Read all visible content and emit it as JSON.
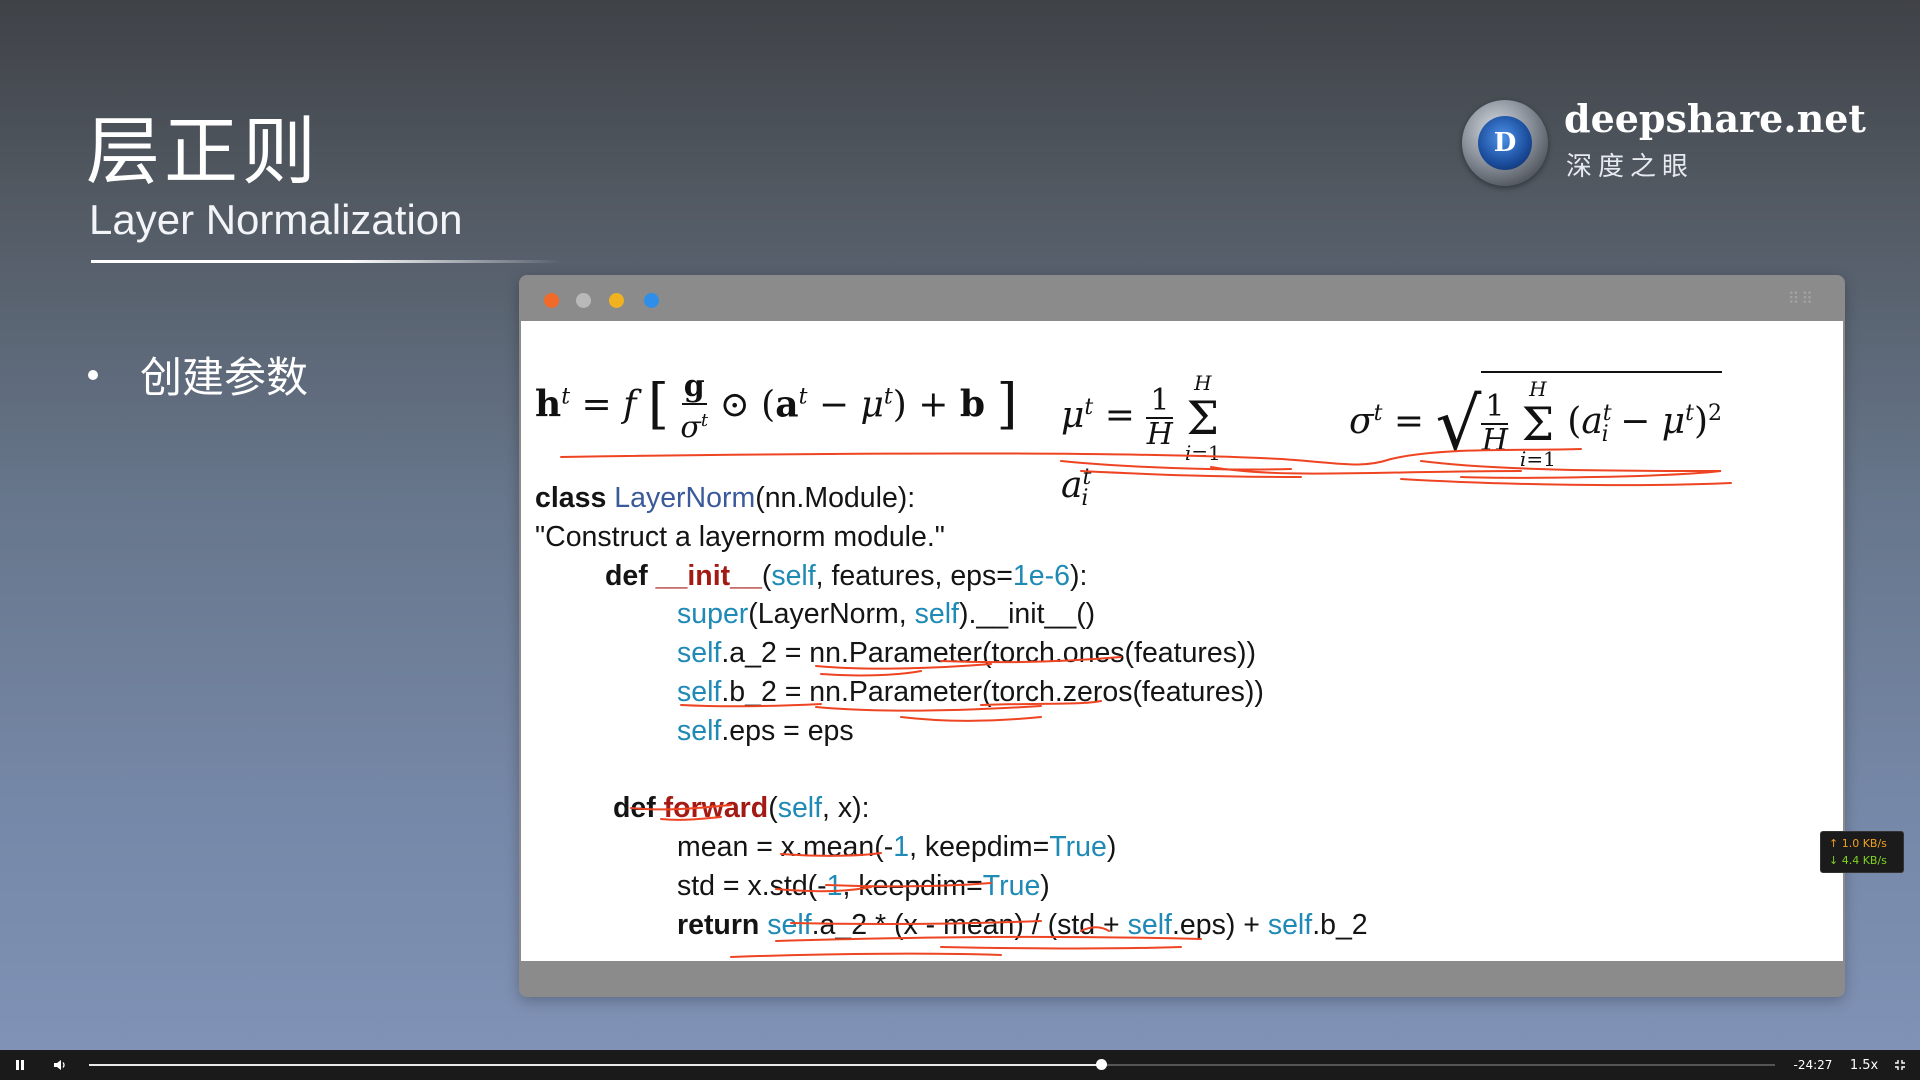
{
  "slide": {
    "title_cn": "层正则",
    "title_en": "Layer Normalization",
    "bullet": "创建参数"
  },
  "logo": {
    "brand": "deepshare.net",
    "brand_cn": "深度之眼",
    "emblem_letter": "D"
  },
  "window": {
    "traffic_light_colors": [
      "#f26a2a",
      "#b9b9b9",
      "#f0b21e",
      "#2f8fe8"
    ],
    "formulas": {
      "h": "hᵗ = f [ g/σᵗ ⊙ (aᵗ − μᵗ) + b ]",
      "mu": "μᵗ = 1/H Σᵢ₌₁ᴴ aᵢᵗ",
      "sigma": "σᵗ = √( 1/H Σᵢ₌₁ᴴ (aᵢᵗ − μᵗ)² )"
    },
    "code": {
      "l1_kw": "class ",
      "l1_name": "LayerNorm",
      "l1_rest": "(nn.Module):",
      "l2": "\"Construct a layernorm module.\"",
      "l3_kw": "def ",
      "l3_fn": "__init__",
      "l3_a": "(",
      "l3_self": "self",
      "l3_b": ", features, eps=",
      "l3_num": "1e-6",
      "l3_c": "):",
      "l4_super": "super",
      "l4_a": "(LayerNorm, ",
      "l4_self": "self",
      "l4_b": ").__init__()",
      "l5_self": "self",
      "l5_rest": ".a_2 = nn.Parameter(torch.ones(features))",
      "l6_self": "self",
      "l6_rest": ".b_2 = nn.Parameter(torch.zeros(features))",
      "l7_self": "self",
      "l7_rest": ".eps = eps",
      "l9_kw": "def ",
      "l9_fn": "forward",
      "l9_a": "(",
      "l9_self": "self",
      "l9_b": ", x):",
      "l10_a": "mean = x.mean(-",
      "l10_num": "1",
      "l10_b": ", keepdim=",
      "l10_true": "True",
      "l10_c": ")",
      "l11_a": "std = x.std(-",
      "l11_num": "1",
      "l11_b": ", keepdim=",
      "l11_true": "True",
      "l11_c": ")",
      "l12_kw": "return ",
      "l12_self1": "self",
      "l12_a": ".a_2 * (x - mean) / (std + ",
      "l12_self2": "self",
      "l12_b": ".eps) + ",
      "l12_self3": "self",
      "l12_c": ".b_2"
    },
    "annotation_color": "#ee4422"
  },
  "net_speed": {
    "up": "↑ 1.0 KB/s",
    "down": "↓ 4.4 KB/s"
  },
  "player": {
    "time_remaining": "-24:27",
    "speed": "1.5x",
    "progress": 0.6
  }
}
